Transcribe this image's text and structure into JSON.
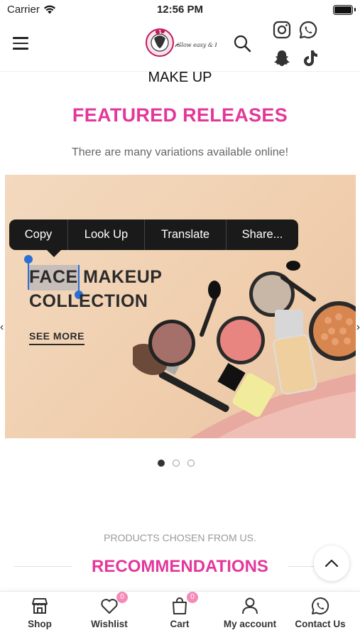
{
  "status_bar": {
    "carrier": "Carrier",
    "time": "12:56 PM"
  },
  "header": {
    "logo_tagline": "Glow easy & Beauty"
  },
  "section_heading": "MAKE UP",
  "featured": {
    "title": "FEATURED RELEASES",
    "subtitle": "There are many variations available online!"
  },
  "banner": {
    "title_word1": "FACE",
    "title_word2": "MAKEUP",
    "title_line2": "COLLECTION",
    "link": "SEE MORE",
    "active_slide": 1,
    "slide_count": 3
  },
  "context_menu": {
    "items": [
      "Copy",
      "Look Up",
      "Translate",
      "Share..."
    ]
  },
  "recommendations": {
    "kicker": "PRODUCTS CHOSEN FROM US.",
    "title": "RECOMMENDATIONS"
  },
  "bottom_nav": {
    "shop": "Shop",
    "wishlist": "Wishlist",
    "wishlist_count": "0",
    "cart": "Cart",
    "cart_count": "0",
    "account": "My account",
    "contact": "Contact Us"
  },
  "icons": [
    "wifi-icon",
    "battery-icon",
    "menu-icon",
    "search-icon",
    "instagram-icon",
    "whatsapp-icon",
    "snapchat-icon",
    "tiktok-icon",
    "chevron-up-icon",
    "shop-icon",
    "heart-icon",
    "bag-icon",
    "user-icon",
    "whatsapp-icon"
  ],
  "colors": {
    "accent": "#e3379b",
    "badge": "#f48ab8",
    "selection": "#2a6fd6"
  }
}
